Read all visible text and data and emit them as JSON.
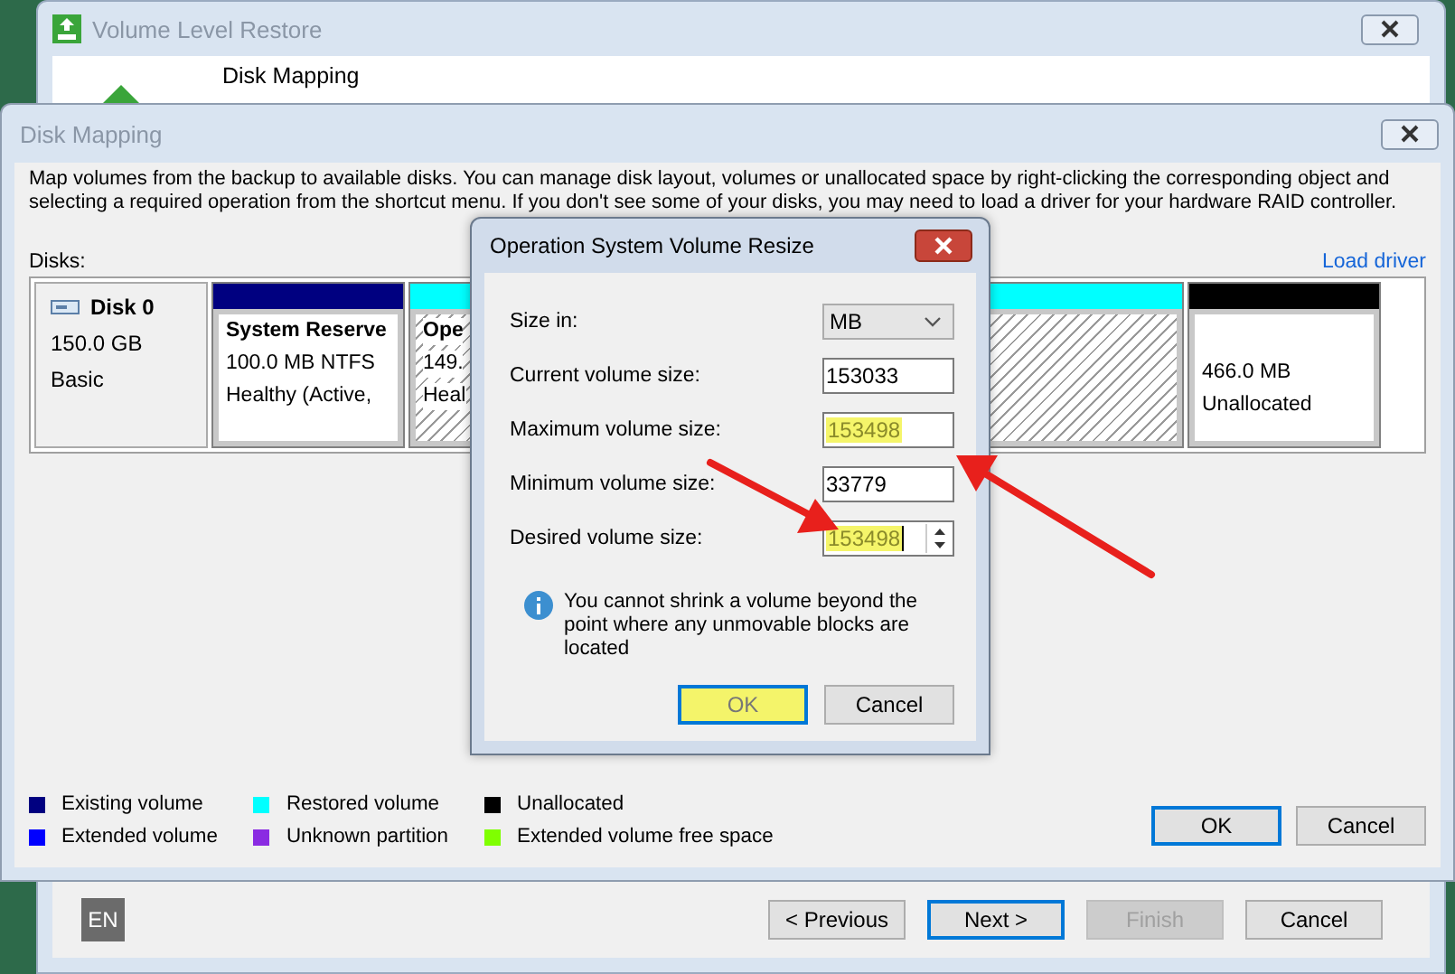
{
  "background_window": {
    "title": "Volume Level Restore",
    "step": "Disk Mapping",
    "language": "EN",
    "buttons": [
      {
        "label": "< Previous",
        "kind": "normal"
      },
      {
        "label": "Next >",
        "kind": "default"
      },
      {
        "label": "Finish",
        "kind": "disabled"
      },
      {
        "label": "Cancel",
        "kind": "normal"
      }
    ]
  },
  "window": {
    "title": "Disk Mapping",
    "description": "Map volumes from the backup to available disks. You can manage disk layout, volumes or unallocated space by right-clicking the corresponding object and selecting a required operation from the shortcut menu. If you don't see some of your disks, you may need to load a driver for your hardware RAID controller.",
    "disks_label": "Disks:",
    "load_driver": "Load driver",
    "disk": {
      "name": "Disk 0",
      "size": "150.0 GB",
      "type": "Basic"
    },
    "partitions": [
      {
        "color": "#000080",
        "hatched": false,
        "title": "System Reserve",
        "lines": [
          "100.0 MB NTFS",
          "Healthy (Active,"
        ]
      },
      {
        "color": "#00ffff",
        "hatched": true,
        "title": "Ope",
        "lines": [
          "149.",
          "Heal"
        ]
      },
      {
        "color": "#000000",
        "hatched": false,
        "lines": [
          "466.0 MB",
          "Unallocated"
        ]
      }
    ],
    "legend": [
      {
        "label": "Existing volume",
        "color": "#000080"
      },
      {
        "label": "Extended volume",
        "color": "#0000ff"
      },
      {
        "label": "Restored volume",
        "color": "#00ffff"
      },
      {
        "label": "Unknown partition",
        "color": "#8a2be2"
      },
      {
        "label": "Unallocated",
        "color": "#000000"
      },
      {
        "label": "Extended volume free space",
        "color": "#7fff00"
      }
    ],
    "buttons": [
      {
        "label": "OK",
        "kind": "default"
      },
      {
        "label": "Cancel",
        "kind": "normal"
      }
    ]
  },
  "dialog": {
    "title": "Operation System Volume Resize",
    "rows": [
      {
        "kind": "dropdown",
        "label": "Size in:",
        "value": "MB"
      },
      {
        "kind": "field",
        "label": "Current volume size:",
        "value": "153033"
      },
      {
        "kind": "field",
        "label": "Maximum volume size:",
        "value": "153498",
        "highlighted": true
      },
      {
        "kind": "field",
        "label": "Minimum volume size:",
        "value": "33779"
      },
      {
        "kind": "spinner",
        "label": "Desired volume size:",
        "value": "153498",
        "highlighted": true
      }
    ],
    "info": "You cannot shrink a volume beyond the point where any unmovable blocks are located",
    "buttons": [
      {
        "label": "OK",
        "kind": "default",
        "highlighted": true
      },
      {
        "label": "Cancel",
        "kind": "normal",
        "highlighted": false
      }
    ]
  }
}
